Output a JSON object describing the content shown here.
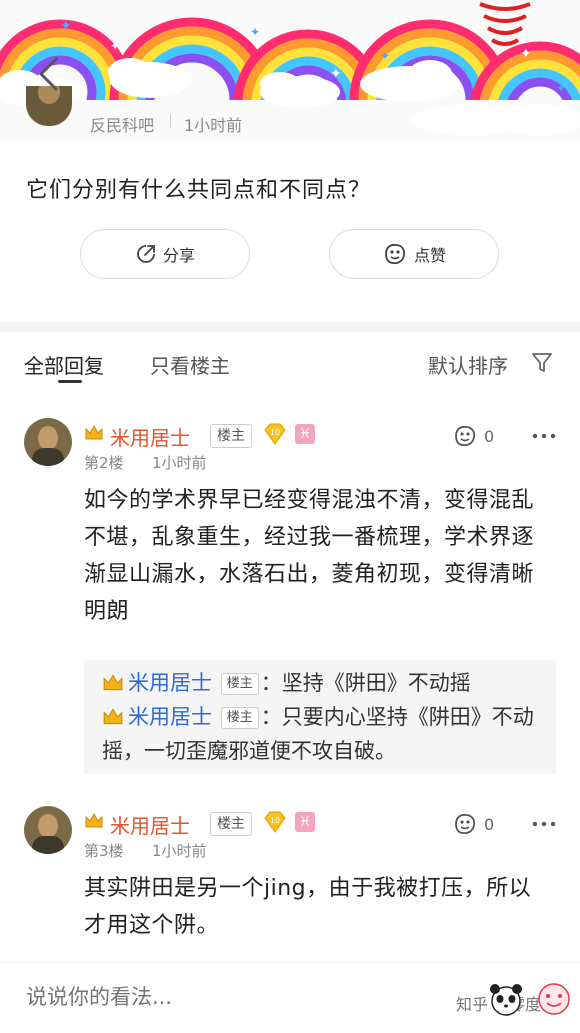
{
  "header": {
    "bar_name": "反民科吧",
    "post_time": "1小时前"
  },
  "question": "它们分别有什么共同点和不同点？",
  "actions": {
    "share_label": "分享",
    "like_label": "点赞"
  },
  "tabs": {
    "all_replies": "全部回复",
    "op_only": "只看楼主",
    "sort": "默认排序"
  },
  "replies": [
    {
      "username": "米用居士",
      "op_tag": "楼主",
      "level": "10",
      "zodiac": "♓",
      "floor": "第2楼",
      "time": "1小时前",
      "likes": "0",
      "content": "如今的学术界早已经变得混浊不清，变得混乱不堪，乱象重生，经过我一番梳理，学术界逐渐显山漏水，水落石出，菱角初现，变得清晰明朗",
      "subreplies": [
        {
          "username": "米用居士",
          "tag": "楼主",
          "text": "坚持《阱田》不动摇"
        },
        {
          "username": "米用居士",
          "tag": "楼主",
          "text": "只要内心坚持《阱田》不动摇，一切歪魔邪道便不攻自破。"
        }
      ]
    },
    {
      "username": "米用居士",
      "op_tag": "楼主",
      "level": "10",
      "zodiac": "♓",
      "floor": "第3楼",
      "time": "1小时前",
      "likes": "0",
      "content": "其实阱田是另一个jing，由于我被打压，所以才用这个阱。"
    }
  ],
  "bottom": {
    "comment_placeholder": "说说你的看法...",
    "watermark": "知乎 @零度君"
  },
  "colors": {
    "username": "#e2552d",
    "sub_username": "#2e6bd6",
    "crown": "#f2b21b"
  }
}
